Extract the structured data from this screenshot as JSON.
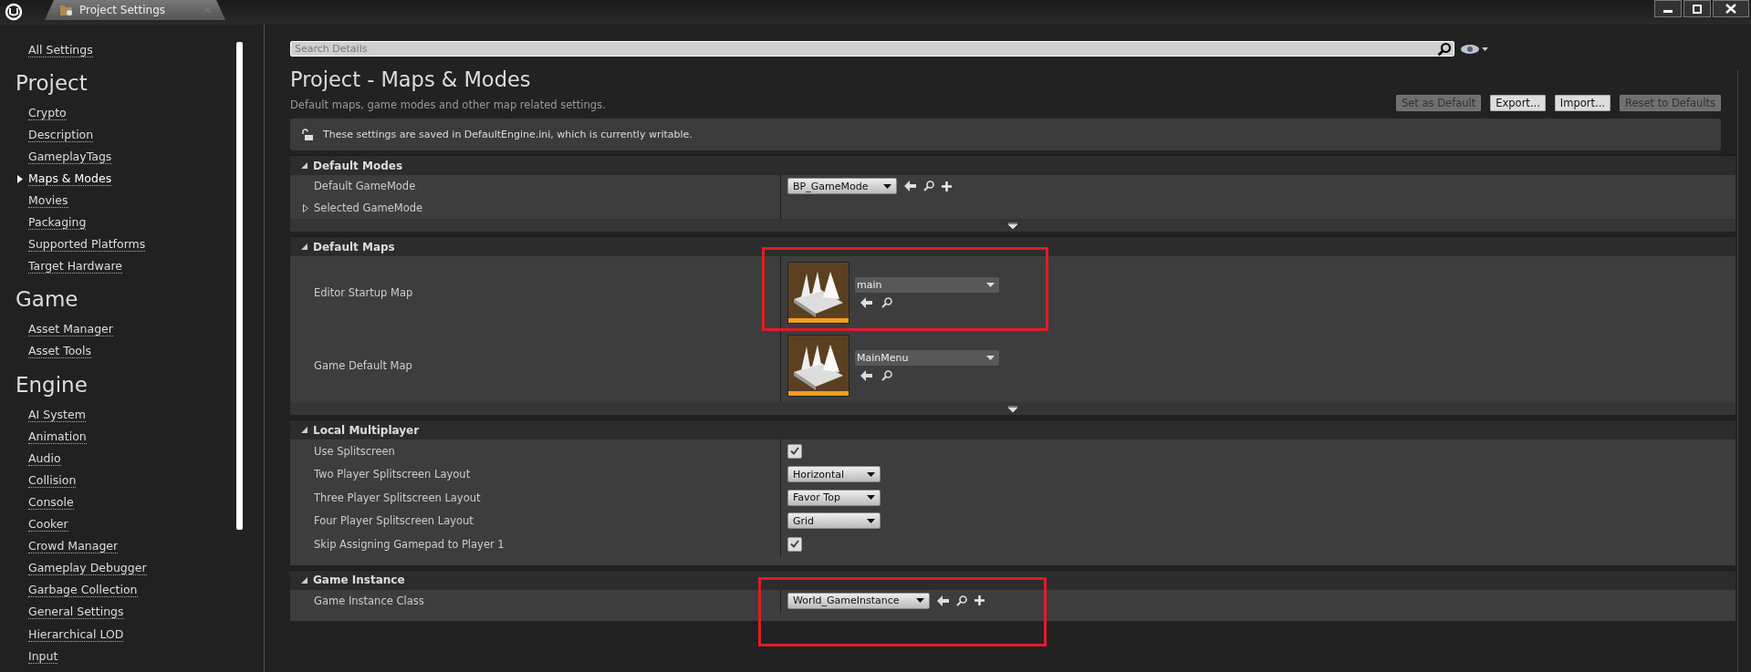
{
  "window": {
    "tab_title": "Project Settings"
  },
  "sidebar": {
    "top_link": "All Settings",
    "groups": [
      {
        "title": "Project",
        "items": [
          {
            "label": "Crypto",
            "selected": false
          },
          {
            "label": "Description",
            "selected": false
          },
          {
            "label": "GameplayTags",
            "selected": false
          },
          {
            "label": "Maps & Modes",
            "selected": true
          },
          {
            "label": "Movies",
            "selected": false
          },
          {
            "label": "Packaging",
            "selected": false
          },
          {
            "label": "Supported Platforms",
            "selected": false
          },
          {
            "label": "Target Hardware",
            "selected": false
          }
        ]
      },
      {
        "title": "Game",
        "items": [
          {
            "label": "Asset Manager",
            "selected": false
          },
          {
            "label": "Asset Tools",
            "selected": false
          }
        ]
      },
      {
        "title": "Engine",
        "items": [
          {
            "label": "AI System",
            "selected": false
          },
          {
            "label": "Animation",
            "selected": false
          },
          {
            "label": "Audio",
            "selected": false
          },
          {
            "label": "Collision",
            "selected": false
          },
          {
            "label": "Console",
            "selected": false
          },
          {
            "label": "Cooker",
            "selected": false
          },
          {
            "label": "Crowd Manager",
            "selected": false
          },
          {
            "label": "Gameplay Debugger",
            "selected": false
          },
          {
            "label": "Garbage Collection",
            "selected": false
          },
          {
            "label": "General Settings",
            "selected": false
          },
          {
            "label": "Hierarchical LOD",
            "selected": false
          },
          {
            "label": "Input",
            "selected": false
          }
        ]
      }
    ]
  },
  "search": {
    "placeholder": "Search Details"
  },
  "page": {
    "title": "Project - Maps & Modes",
    "subtitle": "Default maps, game modes and other map related settings.",
    "buttons": [
      {
        "label": "Set as Default",
        "disabled": true
      },
      {
        "label": "Export...",
        "disabled": false
      },
      {
        "label": "Import...",
        "disabled": false
      },
      {
        "label": "Reset to Defaults",
        "disabled": true
      }
    ],
    "notice": "These settings are saved in DefaultEngine.ini, which is currently writable."
  },
  "sections": [
    {
      "title": "Default Modes",
      "expanded": true,
      "advanced": true,
      "rows": [
        {
          "kind": "class",
          "label": "Default GameMode",
          "value": "BP_GameMode",
          "highlighted": false
        },
        {
          "kind": "group",
          "label": "Selected GameMode",
          "expanded": false
        }
      ]
    },
    {
      "title": "Default Maps",
      "expanded": true,
      "advanced": true,
      "rows": [
        {
          "kind": "map",
          "label": "Editor Startup Map",
          "value": "main",
          "highlighted": true
        },
        {
          "kind": "map",
          "label": "Game Default Map",
          "value": "MainMenu",
          "highlighted": false
        }
      ]
    },
    {
      "title": "Local Multiplayer",
      "expanded": true,
      "advanced": false,
      "rows": [
        {
          "kind": "checkbox",
          "label": "Use Splitscreen",
          "checked": true
        },
        {
          "kind": "enum",
          "label": "Two Player Splitscreen Layout",
          "value": "Horizontal"
        },
        {
          "kind": "enum",
          "label": "Three Player Splitscreen Layout",
          "value": "Favor Top"
        },
        {
          "kind": "enum",
          "label": "Four Player Splitscreen Layout",
          "value": "Grid"
        },
        {
          "kind": "checkbox",
          "label": "Skip Assigning Gamepad to Player 1",
          "checked": true
        }
      ]
    },
    {
      "title": "Game Instance",
      "expanded": true,
      "advanced": false,
      "rows": [
        {
          "kind": "class",
          "label": "Game Instance Class",
          "value": "World_GameInstance",
          "highlighted": true
        }
      ]
    }
  ]
}
